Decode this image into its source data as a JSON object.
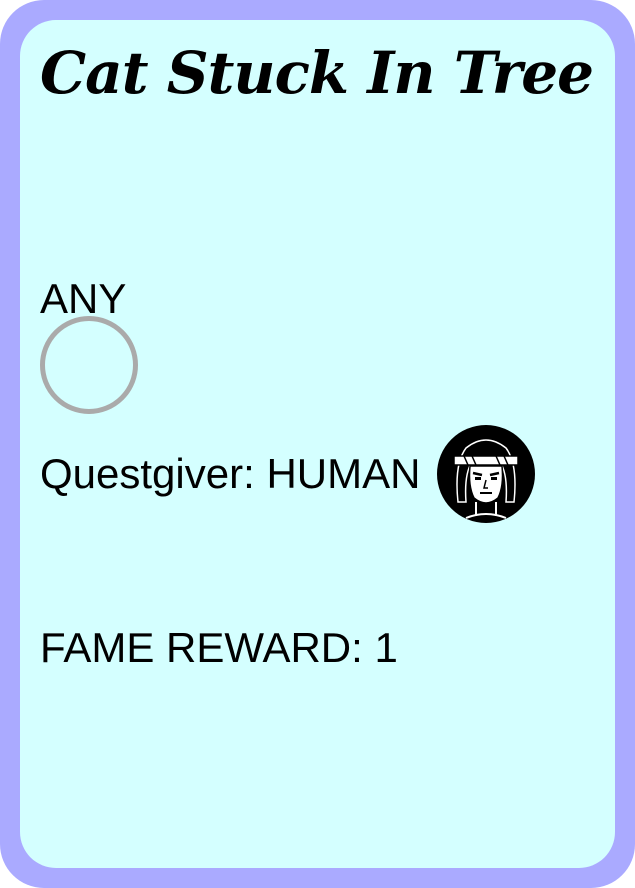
{
  "card": {
    "title": "Cat Stuck In Tree",
    "target": "ANY",
    "questgiver_label": "Questgiver:",
    "questgiver_race": "HUMAN",
    "questgiver_icon": "human-face-icon",
    "fame_label": "FAME REWARD:",
    "fame_value": "1"
  },
  "colors": {
    "border": "#aaaaff",
    "background": "#d4ffff",
    "slot_ring": "#aaaaaa"
  }
}
